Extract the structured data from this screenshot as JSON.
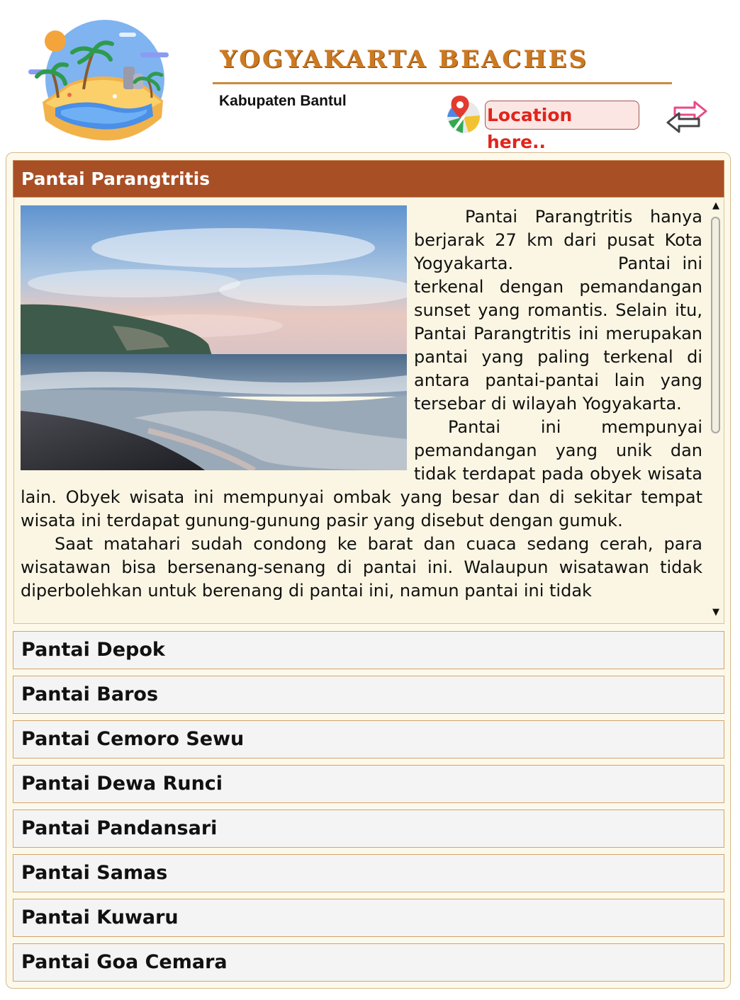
{
  "header": {
    "title": "YOGYAKARTA BEACHES",
    "subtitle": "Kabupaten Bantul",
    "location_button": "Location here..",
    "logo_icon": "island-beach-logo-icon",
    "map_icon": "map-pin-icon",
    "swap_icon": "swap-arrows-icon"
  },
  "accordion": {
    "open_item": {
      "title": "Pantai Parangtritis",
      "paragraphs": [
        "Pantai Parangtritis hanya berjarak 27 km dari pusat Kota Yogyakarta.         Pantai ini terkenal dengan pemandangan sunset yang romantis. Selain itu, Pantai Parangtritis ini merupakan pantai yang paling terkenal di antara pantai-pantai lain yang tersebar di wilayah Yogyakarta.",
        "Pantai ini mempunyai pemandangan yang unik dan tidak terdapat pada obyek wisata lain. Obyek wisata ini mempunyai ombak yang besar dan di sekitar tempat wisata ini terdapat gunung-gunung pasir yang disebut dengan gumuk.",
        "Saat matahari sudah condong ke barat dan cuaca sedang cerah, para wisatawan bisa bersenang-senang di pantai ini. Walaupun wisatawan tidak diperbolehkan untuk berenang di pantai ini, namun pantai ini tidak"
      ]
    },
    "items": [
      {
        "title": "Pantai Depok"
      },
      {
        "title": "Pantai Baros"
      },
      {
        "title": "Pantai Cemoro Sewu"
      },
      {
        "title": "Pantai Dewa Runci"
      },
      {
        "title": "Pantai Pandansari"
      },
      {
        "title": "Pantai Samas"
      },
      {
        "title": "Pantai Kuwaru"
      },
      {
        "title": "Pantai Goa Cemara"
      }
    ]
  },
  "colors": {
    "title": "#cc7a22",
    "open_header_bg": "#a94f25",
    "panel_bg": "#fdf9ea",
    "item_bg": "#f4f4f4",
    "item_border": "#d1a46e",
    "location_text": "#e0241c",
    "location_bg": "#fbe6e4"
  }
}
